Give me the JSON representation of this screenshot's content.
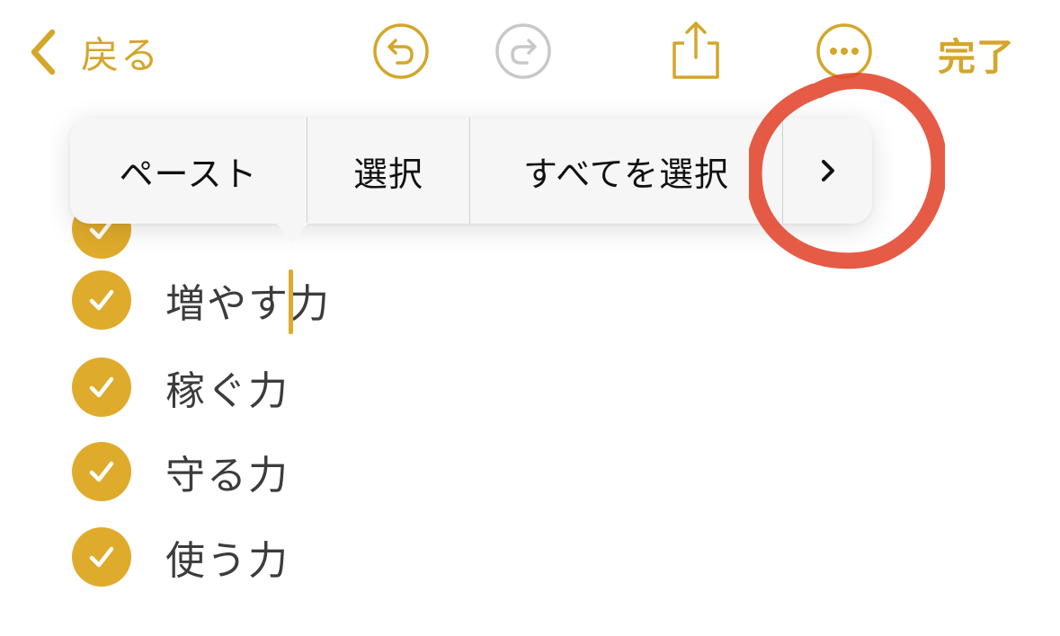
{
  "nav": {
    "back_label": "戻る",
    "done_label": "完了",
    "accent_color": "#d4a62a",
    "redo_color": "#c8c8c8"
  },
  "context_menu": {
    "items": [
      "ペースト",
      "選択",
      "すべてを選択"
    ],
    "more_icon": "chevron-right-icon"
  },
  "checklist": {
    "items": [
      {
        "text": "",
        "checked": true
      },
      {
        "text": "増やす力",
        "checked": true
      },
      {
        "text": "稼ぐ力",
        "checked": true
      },
      {
        "text": "守る力",
        "checked": true
      },
      {
        "text": "使う力",
        "checked": true
      }
    ],
    "check_color": "#dfab2c"
  },
  "annotation": {
    "color": "#e1442c"
  }
}
